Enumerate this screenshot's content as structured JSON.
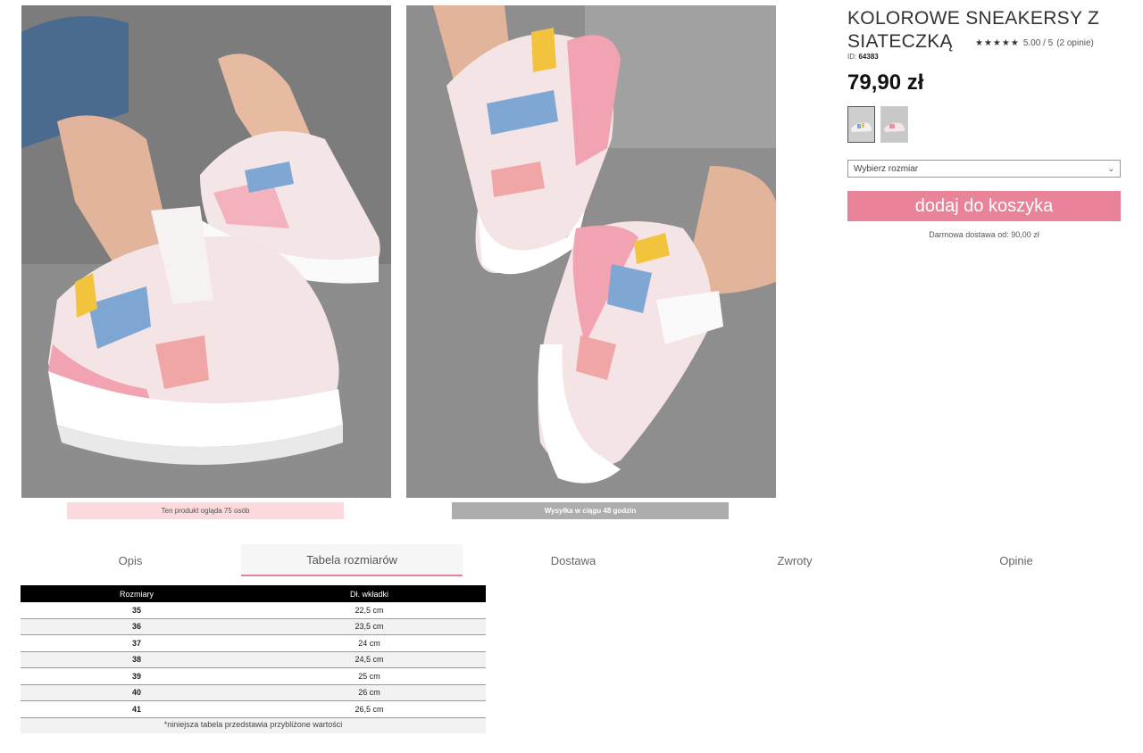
{
  "gallery": {
    "images": [
      {
        "alt": "Kolorowe sneakersy z siateczką - zdjęcie 1"
      },
      {
        "alt": "Kolorowe sneakersy z siateczką - zdjęcie 2"
      }
    ],
    "viewers_banner": "Ten produkt ogląda 75 osób",
    "shipping_banner": "Wysyłka w ciągu 48 godzin"
  },
  "product": {
    "title": "KOLOROWE SNEAKERSY Z SIATECZKĄ",
    "stars": "★★★★★",
    "rating_value": "5.00 / 5",
    "rating_count": "(2 opinie)",
    "id_label": "ID:",
    "id_value": "64383",
    "price": "79,90 zł",
    "size_select_placeholder": "Wybierz rozmiar",
    "add_to_cart": "dodaj do koszyka",
    "free_shipping": "Darmowa dostawa od: 90,00 zł"
  },
  "tabs": [
    {
      "label": "Opis"
    },
    {
      "label": "Tabela rozmiarów"
    },
    {
      "label": "Dostawa"
    },
    {
      "label": "Zwroty"
    },
    {
      "label": "Opinie"
    }
  ],
  "size_table": {
    "headers": [
      "Rozmiary",
      "Dł. wkładki"
    ],
    "rows": [
      [
        "35",
        "22,5 cm"
      ],
      [
        "36",
        "23,5 cm"
      ],
      [
        "37",
        "24 cm"
      ],
      [
        "38",
        "24,5 cm"
      ],
      [
        "39",
        "25 cm"
      ],
      [
        "40",
        "26 cm"
      ],
      [
        "41",
        "26,5 cm"
      ]
    ],
    "footnote": "*niniejsza tabela przedstawia przybliżone wartości"
  },
  "colors": {
    "accent": "#e8839a",
    "viewers_banner_bg": "#fbd9dc",
    "shipping_banner_bg": "#adadad"
  }
}
